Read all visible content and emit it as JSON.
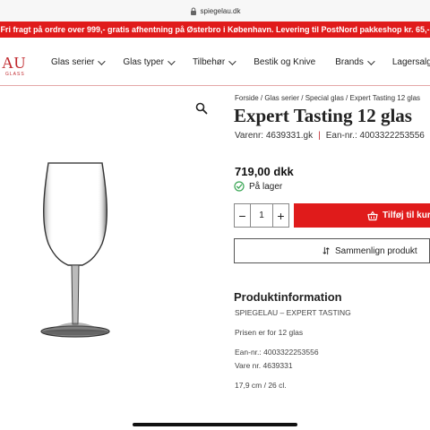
{
  "browser": {
    "url": "spiegelau.dk"
  },
  "promo": {
    "text": "Fri fragt på ordre over 999,- gratis afhentning på Østerbro i København. Levering til PostNord pakkeshop kr. 65,-"
  },
  "logo": {
    "text": "AU",
    "sub": "GLASS"
  },
  "nav": {
    "items": [
      {
        "label": "Glas serier",
        "dropdown": true
      },
      {
        "label": "Glas typer",
        "dropdown": true
      },
      {
        "label": "Tilbehør",
        "dropdown": true
      },
      {
        "label": "Bestik og Knive",
        "dropdown": false
      },
      {
        "label": "Brands",
        "dropdown": true
      },
      {
        "label": "Lagersalg",
        "dropdown": false
      }
    ]
  },
  "breadcrumb": "Forside / Glas serier / Special glas / Expert Tasting 12 glas",
  "product": {
    "title": "Expert Tasting 12 glas",
    "varenr": "Varenr: 4639331.gk",
    "separator": "|",
    "ean": "Ean-nr.: 4003322253556",
    "price": "719,00 dkk",
    "stock": "På lager",
    "quantity": "1",
    "add_to_cart": "Tilføj til kurv",
    "compare": "Sammenlign produkt"
  },
  "info": {
    "title": "Produktinformation",
    "lines": [
      "SPIEGELAU – EXPERT TASTING",
      "Prisen er for 12 glas",
      "Ean-nr.: 4003322253556",
      "Vare nr. 4639331",
      "17,9 cm / 26 cl."
    ]
  },
  "colors": {
    "accent": "#e01b1b",
    "brand": "#c0282d",
    "stock_icon": "#3aa655"
  },
  "icons": [
    "lock-icon",
    "chevron-down-icon",
    "zoom-icon",
    "in-stock-icon",
    "basket-icon",
    "compare-icon"
  ]
}
